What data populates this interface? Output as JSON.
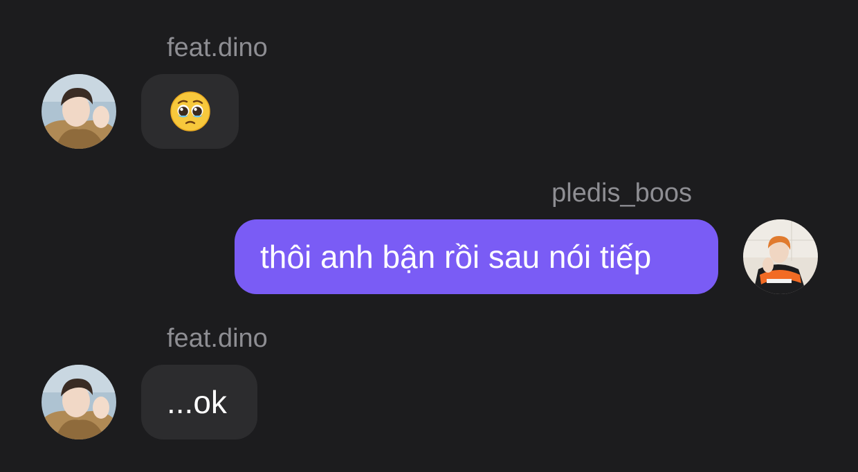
{
  "conversation": {
    "messages": [
      {
        "sender": "feat.dino",
        "direction": "incoming",
        "type": "emoji",
        "emoji_name": "pleading-face-emoji",
        "avatar_icon": "avatar-feat-dino"
      },
      {
        "sender": "pledis_boos",
        "direction": "outgoing",
        "type": "text",
        "text": "thôi anh bận rồi sau nói tiếp",
        "avatar_icon": "avatar-pledis-boos"
      },
      {
        "sender": "feat.dino",
        "direction": "incoming",
        "type": "text",
        "text": "...ok",
        "avatar_icon": "avatar-feat-dino"
      }
    ]
  },
  "colors": {
    "background": "#1c1c1e",
    "incoming_bubble": "#2c2c2e",
    "outgoing_bubble": "#7a5cf5",
    "sender_name": "#8e8e93",
    "message_text": "#ffffff"
  }
}
